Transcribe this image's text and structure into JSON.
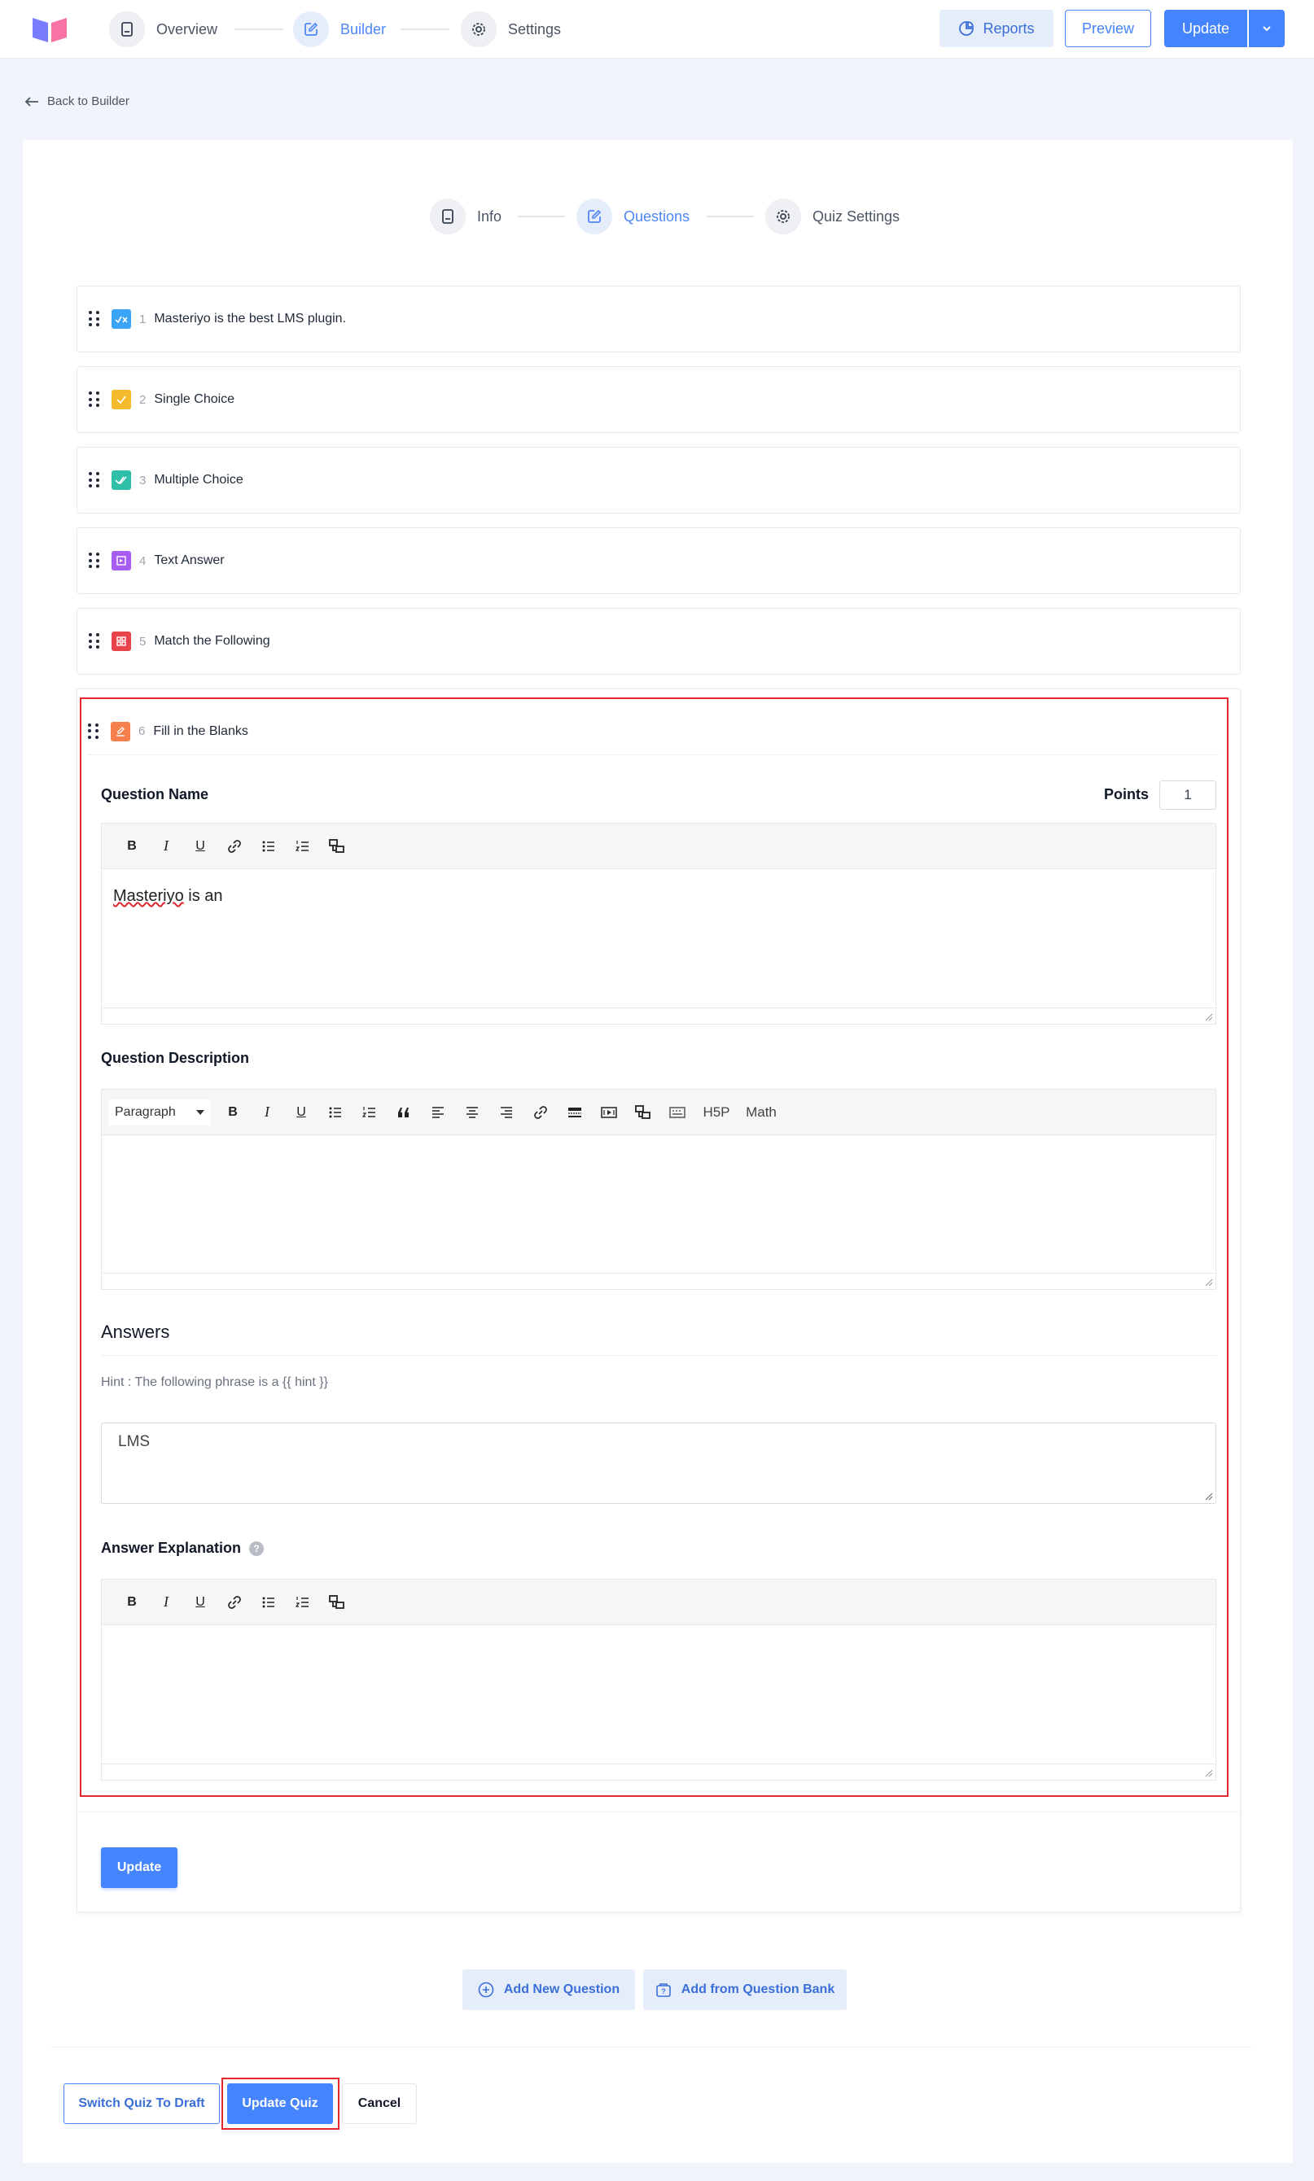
{
  "topbar": {
    "steps": [
      {
        "label": "Overview",
        "icon": "book-icon",
        "active": false
      },
      {
        "label": "Builder",
        "icon": "edit-icon",
        "active": true
      },
      {
        "label": "Settings",
        "icon": "gear-icon",
        "active": false
      }
    ],
    "reports_label": "Reports",
    "preview_label": "Preview",
    "update_label": "Update"
  },
  "back_link": "Back to Builder",
  "quiz_steps": [
    {
      "label": "Info",
      "icon": "book-icon",
      "active": false
    },
    {
      "label": "Questions",
      "icon": "edit-icon",
      "active": true
    },
    {
      "label": "Quiz Settings",
      "icon": "gear-icon",
      "active": false
    }
  ],
  "questions": [
    {
      "num": "1",
      "title": "Masteriyo is the best LMS plugin.",
      "color": "#3ba4f6",
      "icon": "true-false-icon"
    },
    {
      "num": "2",
      "title": "Single Choice",
      "color": "#f5b92c",
      "icon": "single-choice-icon"
    },
    {
      "num": "3",
      "title": "Multiple Choice",
      "color": "#2fbfa8",
      "icon": "multiple-choice-icon"
    },
    {
      "num": "4",
      "title": "Text Answer",
      "color": "#a75cf2",
      "icon": "text-answer-icon"
    },
    {
      "num": "5",
      "title": "Match the Following",
      "color": "#e8424b",
      "icon": "match-icon"
    }
  ],
  "expanded": {
    "num": "6",
    "title": "Fill in the Blanks",
    "color": "#f5804e",
    "icon": "fill-blanks-icon",
    "question_name_label": "Question Name",
    "points_label": "Points",
    "points_value": "1",
    "question_name_text_word": "Masteriyo",
    "question_name_text_rest": " is an",
    "question_description_label": "Question Description",
    "paragraph_select": "Paragraph",
    "h5p_label": "H5P",
    "math_label": "Math",
    "answers_heading": "Answers",
    "hint_text": "Hint : The following phrase is a {{ hint }}",
    "answer_value": "LMS",
    "answer_explanation_label": "Answer Explanation",
    "update_button": "Update"
  },
  "add_new_question": "Add New Question",
  "add_from_bank": "Add from Question Bank",
  "footer": {
    "switch_draft": "Switch Quiz To Draft",
    "update_quiz": "Update Quiz",
    "cancel": "Cancel"
  }
}
